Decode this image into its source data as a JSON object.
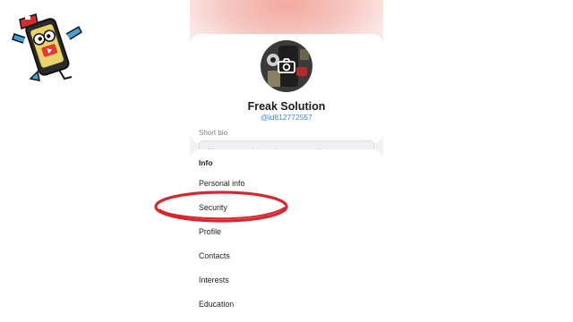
{
  "profile": {
    "name": "Freak Solution",
    "handle": "@id812772557",
    "bio_label": "Short bio",
    "bio_placeholder": "Share something about yourself"
  },
  "info": {
    "title": "Info",
    "items": [
      {
        "label": "Personal info"
      },
      {
        "label": "Security"
      },
      {
        "label": "Profile"
      },
      {
        "label": "Contacts"
      },
      {
        "label": "Interests"
      },
      {
        "label": "Education"
      }
    ]
  },
  "icons": {
    "mascot": "phone-mascot-icon",
    "camera": "camera-icon"
  },
  "colors": {
    "highlight_ring": "#d8262e",
    "handle_link": "#4a86c5",
    "cover_gradient": "#f2a9a0"
  }
}
